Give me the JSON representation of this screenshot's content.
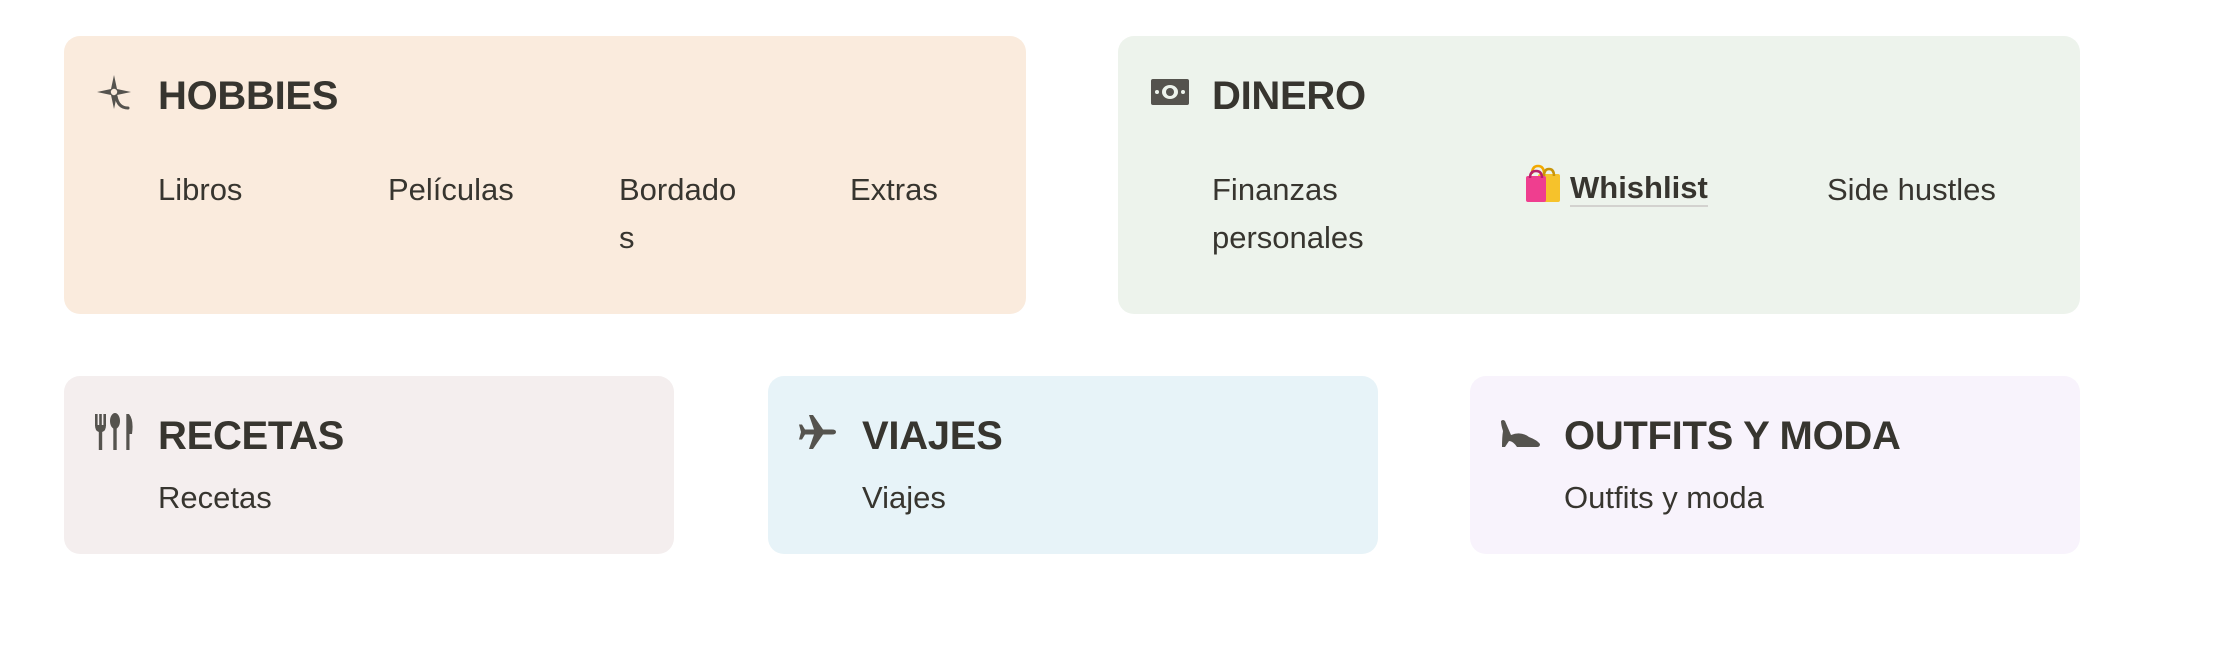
{
  "colors": {
    "text": "#37352f",
    "icon": "#55534e",
    "hobbies_bg": "#faebdd",
    "dinero_bg": "#edf3ec",
    "recetas_bg": "#f4eeee",
    "viajes_bg": "#e7f3f8",
    "outfits_bg": "#f8f3fc"
  },
  "cards": {
    "hobbies": {
      "icon": "compass-drafting-icon",
      "title": "HOBBIES",
      "links": {
        "libros": "Libros",
        "peliculas": "Películas",
        "bordados_line1": "Bordado",
        "bordados_line2": "s",
        "extras": "Extras"
      }
    },
    "dinero": {
      "icon": "money-bill-icon",
      "title": "DINERO",
      "links": {
        "finanzas_line1": "Finanzas",
        "finanzas_line2": "personales",
        "whishlist_icon": "shopping-bags-icon",
        "whishlist": "Whishlist",
        "side_hustles": "Side hustles"
      }
    },
    "recetas": {
      "icon": "utensils-icon",
      "title": "RECETAS",
      "links": {
        "recetas": "Recetas"
      }
    },
    "viajes": {
      "icon": "airplane-icon",
      "title": "VIAJES",
      "links": {
        "viajes": "Viajes"
      }
    },
    "outfits": {
      "icon": "high-heel-icon",
      "title": "OUTFITS Y MODA",
      "links": {
        "outfits": "Outfits y moda"
      }
    }
  }
}
